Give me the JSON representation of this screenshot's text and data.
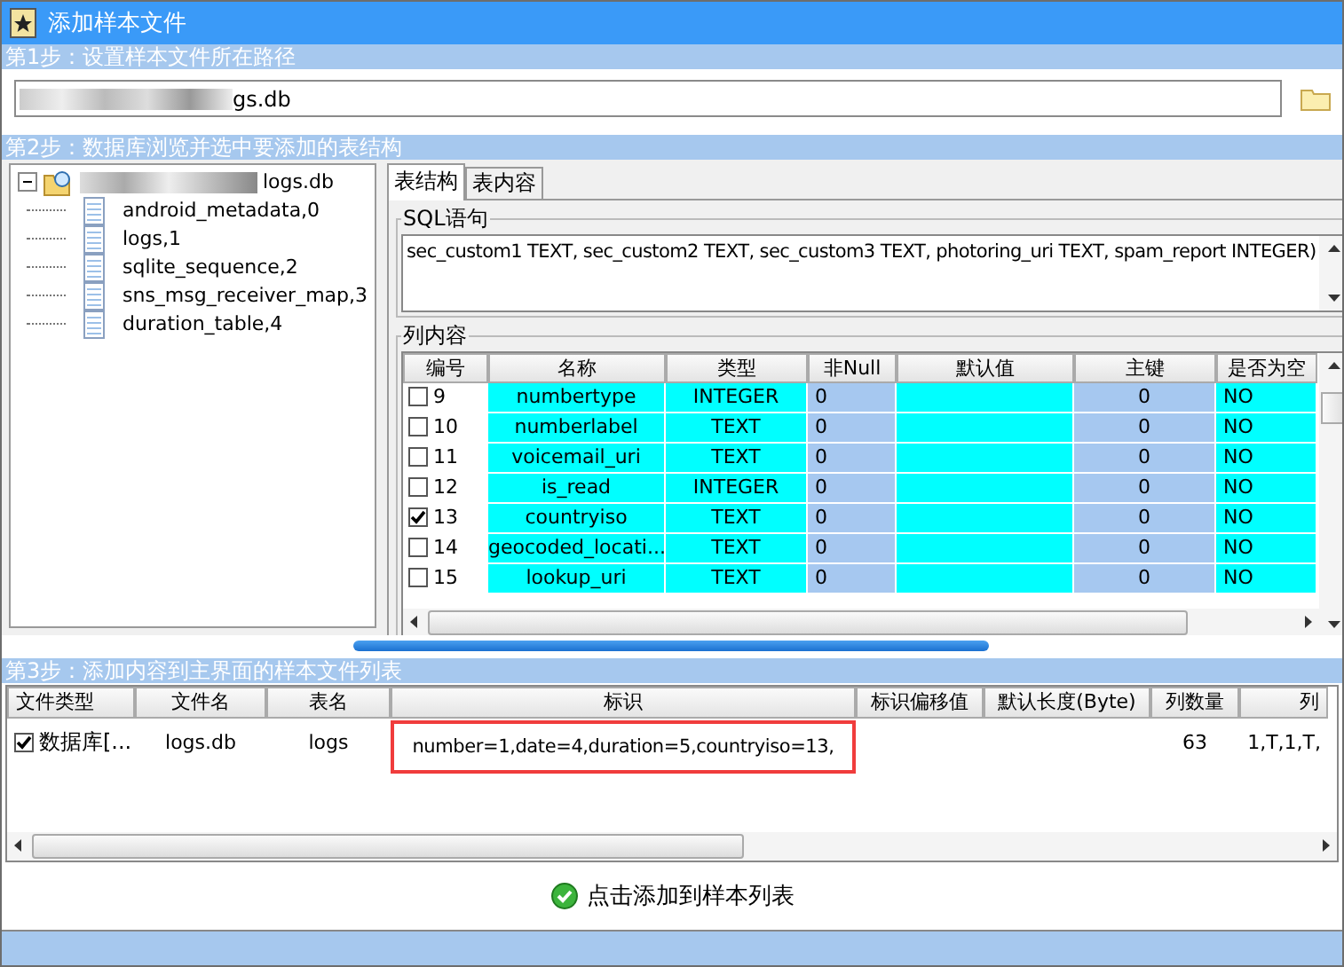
{
  "window": {
    "title": "添加样本文件"
  },
  "step1": {
    "header": "第1步：设置样本文件所在路径",
    "path_value": "gs.db"
  },
  "step2": {
    "header": "第2步：数据库浏览并选中要添加的表结构",
    "tree": {
      "label": "logs.db",
      "expanded": true,
      "children": [
        {
          "label": "android_metadata,0"
        },
        {
          "label": "logs,1"
        },
        {
          "label": "sqlite_sequence,2"
        },
        {
          "label": "sns_msg_receiver_map,3"
        },
        {
          "label": "duration_table,4"
        }
      ]
    },
    "tabs": [
      {
        "label": "表结构",
        "selected": true
      },
      {
        "label": "表内容",
        "selected": false
      }
    ],
    "sql_group": {
      "title": "SQL语句",
      "text": "sec_custom1 TEXT, sec_custom2 TEXT, sec_custom3 TEXT, photoring_uri TEXT, spam_report INTEGER)"
    },
    "columns_group": {
      "title": "列内容",
      "columns": [
        "编号",
        "名称",
        "类型",
        "非Null",
        "默认值",
        "主键",
        "是否为空"
      ],
      "rows": [
        {
          "checked": false,
          "cells": [
            "9",
            "numbertype",
            "INTEGER",
            "0",
            "",
            "0",
            "NO"
          ]
        },
        {
          "checked": false,
          "cells": [
            "10",
            "numberlabel",
            "TEXT",
            "0",
            "",
            "0",
            "NO"
          ]
        },
        {
          "checked": false,
          "cells": [
            "11",
            "voicemail_uri",
            "TEXT",
            "0",
            "",
            "0",
            "NO"
          ]
        },
        {
          "checked": false,
          "cells": [
            "12",
            "is_read",
            "INTEGER",
            "0",
            "",
            "0",
            "NO"
          ]
        },
        {
          "checked": true,
          "cells": [
            "13",
            "countryiso",
            "TEXT",
            "0",
            "",
            "0",
            "NO"
          ]
        },
        {
          "checked": false,
          "cells": [
            "14",
            "geocoded_locati...",
            "TEXT",
            "0",
            "",
            "0",
            "NO"
          ]
        },
        {
          "checked": false,
          "cells": [
            "15",
            "lookup_uri",
            "TEXT",
            "0",
            "",
            "0",
            "NO"
          ]
        }
      ]
    }
  },
  "step3": {
    "header": "第3步：添加内容到主界面的样本文件列表",
    "columns": [
      "文件类型",
      "文件名",
      "表名",
      "标识",
      "标识偏移值",
      "默认长度(Byte)",
      "列数量",
      "列"
    ],
    "rows": [
      {
        "checked": true,
        "identifier_highlighted": true,
        "cells": [
          "数据库[...",
          "logs.db",
          "logs",
          "number=1,date=4,duration=5,countryiso=13,",
          "",
          "",
          "63",
          "1,T,1,T,"
        ]
      }
    ]
  },
  "add_button": {
    "label": "点击添加到样本列表"
  }
}
